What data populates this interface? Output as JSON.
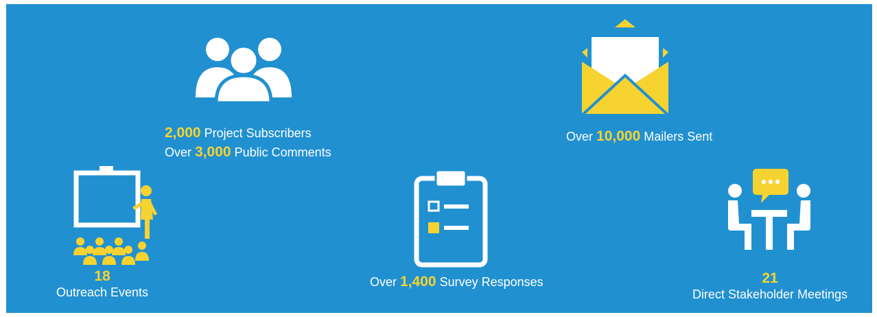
{
  "colors": {
    "background": "#2190d0",
    "accent": "#f6d330",
    "text": "#ffffff"
  },
  "subscribers": {
    "icon": "people-group-icon",
    "line1": {
      "number": "2,000",
      "text": " Project Subscribers"
    },
    "line2": {
      "prefix": "Over ",
      "number": "3,000",
      "text": " Public Comments"
    }
  },
  "mailers": {
    "icon": "open-envelope-icon",
    "line": {
      "prefix": "Over ",
      "number": "10,000",
      "text": " Mailers Sent"
    }
  },
  "events": {
    "icon": "presentation-audience-icon",
    "number": "18",
    "label": "Outreach Events"
  },
  "survey": {
    "icon": "clipboard-checklist-icon",
    "line": {
      "prefix": "Over ",
      "number": "1,400",
      "text": " Survey Responses"
    }
  },
  "meetings": {
    "icon": "meeting-chat-icon",
    "number": "21",
    "label": "Direct Stakeholder Meetings"
  }
}
